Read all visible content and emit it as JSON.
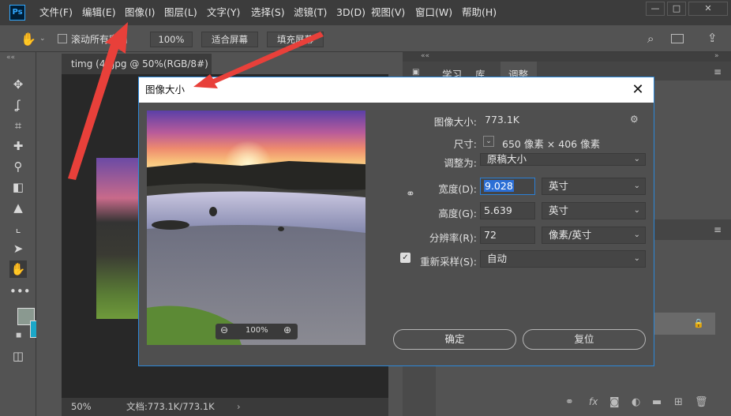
{
  "app": {
    "logo": "Ps"
  },
  "menu": [
    "文件(F)",
    "编辑(E)",
    "图像(I)",
    "图层(L)",
    "文字(Y)",
    "选择(S)",
    "滤镜(T)",
    "3D(D)",
    "视图(V)",
    "窗口(W)",
    "帮助(H)"
  ],
  "options": {
    "scroll_all": "滚动所有窗口",
    "zoom": "100%",
    "fit_screen": "适合屏幕",
    "fill_screen": "填充屏幕"
  },
  "document": {
    "tab_title": "timg (4).jpg @ 50%(RGB/8#)",
    "zoom": "50%",
    "doc_info": "文档:773.1K/773.1K"
  },
  "panels": {
    "tabs": [
      "学习",
      "库",
      "调整"
    ]
  },
  "dialog": {
    "title": "图像大小",
    "image_size_label": "图像大小:",
    "image_size_value": "773.1K",
    "dimensions_label": "尺寸:",
    "dimensions_value": "650 像素 × 406 像素",
    "fit_to_label": "调整为:",
    "fit_to_value": "原稿大小",
    "width_label": "宽度(D):",
    "width_value": "9.028",
    "width_unit": "英寸",
    "height_label": "高度(G):",
    "height_value": "5.639",
    "height_unit": "英寸",
    "resolution_label": "分辨率(R):",
    "resolution_value": "72",
    "resolution_unit": "像素/英寸",
    "resample_label": "重新采样(S):",
    "resample_value": "自动",
    "preview_zoom": "100%",
    "ok": "确定",
    "reset": "复位"
  },
  "colors": {
    "accent": "#2c88d9",
    "foreground": "#8a9990",
    "background": "#1ba7c8",
    "arrow": "#e8403a"
  }
}
